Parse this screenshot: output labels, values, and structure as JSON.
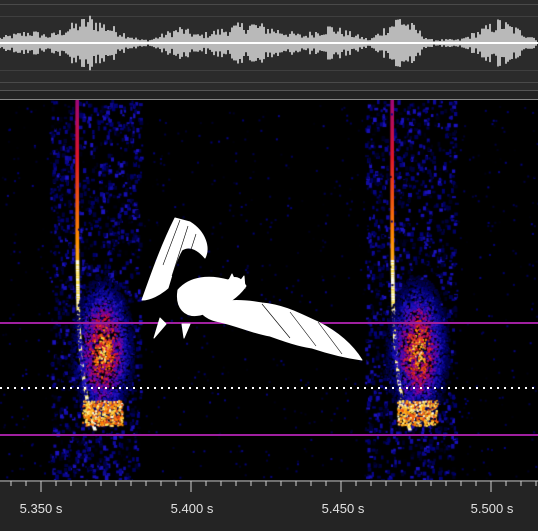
{
  "waveform": {
    "wave_color": "#b9b9b9",
    "center_line_color": "#ffffff",
    "background": "#2b2b2b"
  },
  "spectrogram": {
    "colormap": "black-blue-red-yellow-white",
    "background": "#000000",
    "selection_line_color": "#a020a0",
    "cursor_line_color": "#ffffff",
    "overlay_icon": "bat-icon"
  },
  "time_axis": {
    "ticks": [
      {
        "label": "5.350 s"
      },
      {
        "label": "5.400 s"
      },
      {
        "label": "5.450 s"
      },
      {
        "label": "5.500 s"
      }
    ]
  }
}
